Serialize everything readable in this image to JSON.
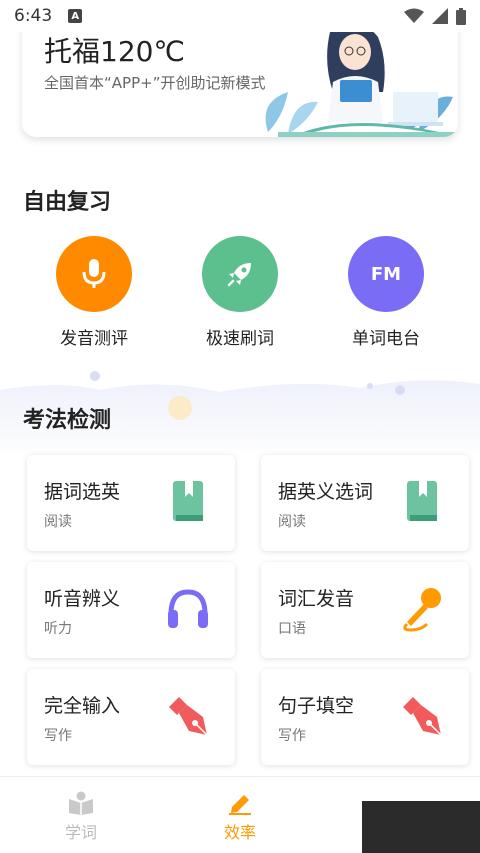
{
  "status_bar": {
    "time": "6:43",
    "notification_letter": "A"
  },
  "banner": {
    "title": "托福120℃",
    "subtitle": "全国首本“APP+”开创助记新模式"
  },
  "free_review": {
    "title": "自由复习",
    "items": [
      {
        "label": "发音测评",
        "icon": "microphone-icon",
        "color": "#FF8A00"
      },
      {
        "label": "极速刷词",
        "icon": "rocket-icon",
        "color": "#5BBF8E"
      },
      {
        "label": "单词电台",
        "icon": "FM",
        "color": "#7B6CF6"
      }
    ]
  },
  "exam": {
    "title": "考法检测",
    "cards": [
      {
        "title": "据词选英",
        "sub": "阅读",
        "icon": "book-icon"
      },
      {
        "title": "据英义选词",
        "sub": "阅读",
        "icon": "book-icon"
      },
      {
        "title": "听音辨义",
        "sub": "听力",
        "icon": "headphones-icon"
      },
      {
        "title": "词汇发音",
        "sub": "口语",
        "icon": "microphone-icon"
      },
      {
        "title": "完全输入",
        "sub": "写作",
        "icon": "pen-nib-icon"
      },
      {
        "title": "句子填空",
        "sub": "写作",
        "icon": "pen-nib-icon"
      }
    ]
  },
  "nav": {
    "tabs": [
      {
        "label": "学词",
        "active": false
      },
      {
        "label": "效率",
        "active": true
      }
    ],
    "accent": "#FF9A00"
  }
}
